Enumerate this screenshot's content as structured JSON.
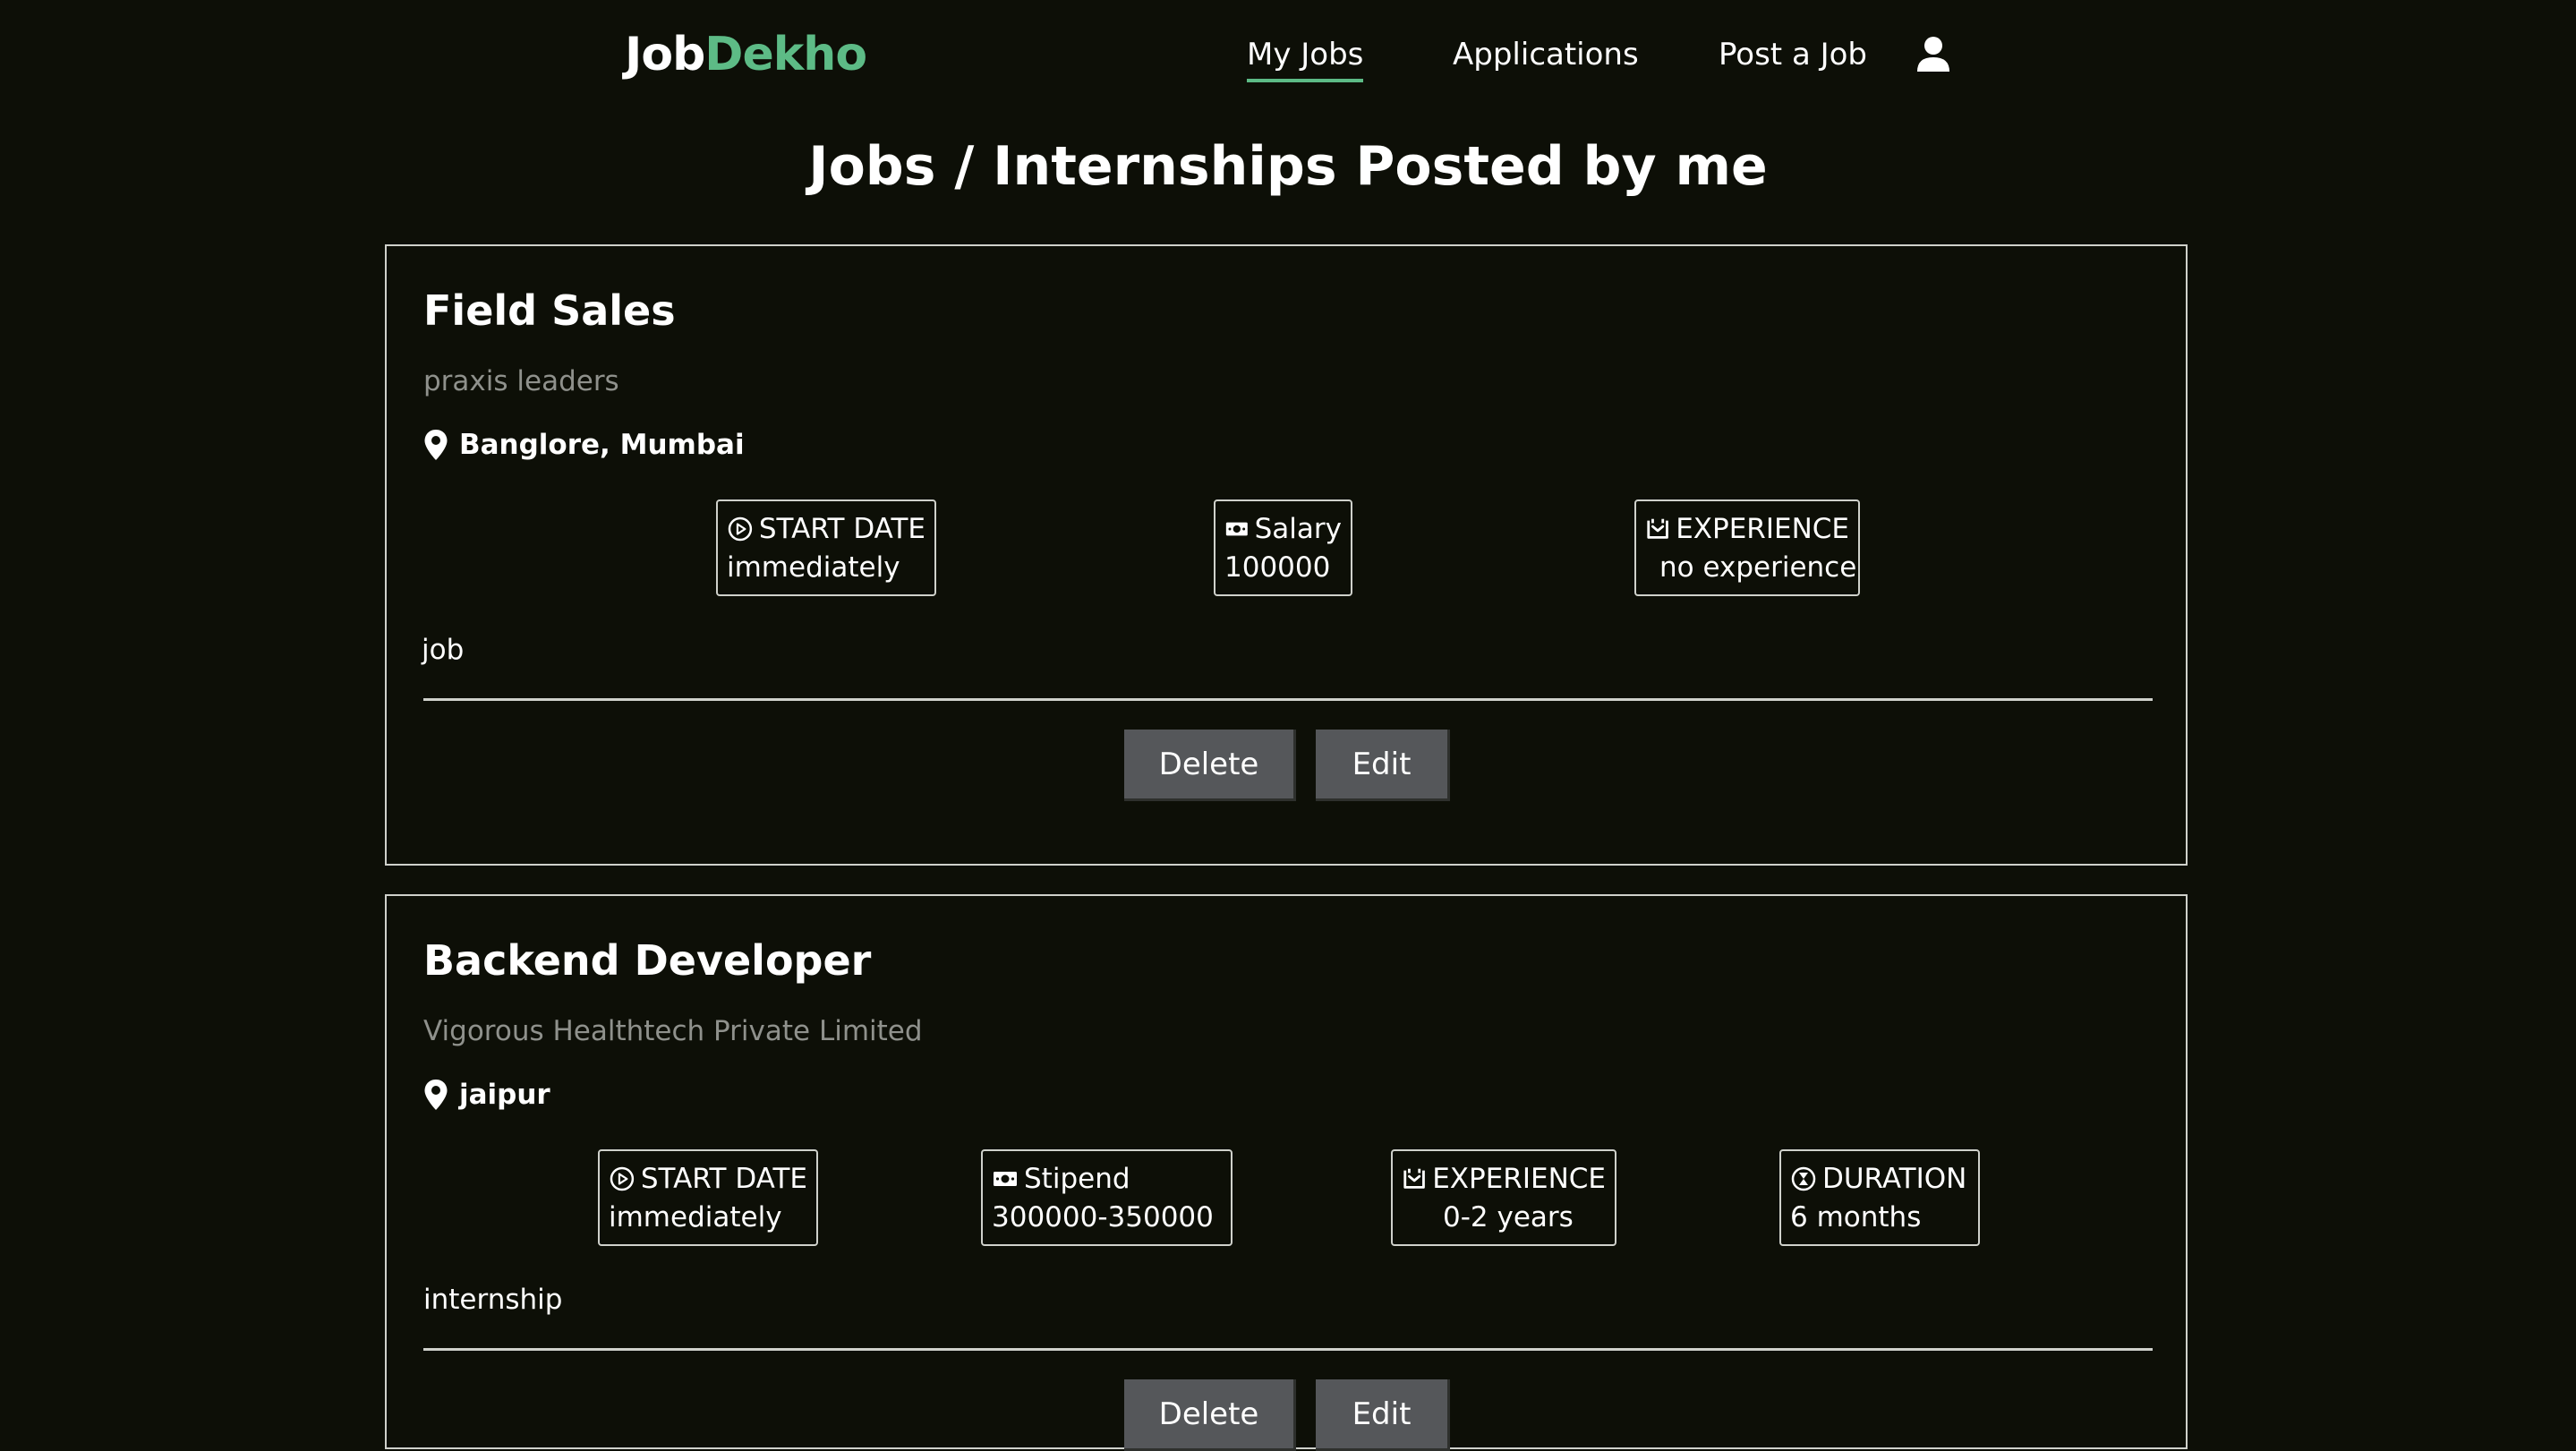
{
  "navbar": {
    "logo_part1": "Job",
    "logo_part2": "Dekho",
    "links": {
      "my_jobs": "My Jobs",
      "applications": "Applications",
      "post_job": "Post a Job"
    },
    "user_icon": "user-icon",
    "accent_color": "#5dbb86"
  },
  "page": {
    "title": "Jobs / Internships Posted by me"
  },
  "jobs": [
    {
      "title": "Field Sales",
      "company": "praxis leaders",
      "location": "Banglore, Mumbai",
      "start_label": "START DATE",
      "start_value": "immediately",
      "pay_label": "Salary",
      "pay_value": "100000",
      "exp_label": "EXPERIENCE",
      "exp_value": "no experience",
      "type": "job",
      "delete_label": "Delete",
      "edit_label": "Edit"
    },
    {
      "title": "Backend Developer",
      "company": "Vigorous Healthtech Private Limited",
      "location": "jaipur",
      "start_label": "START DATE",
      "start_value": "immediately",
      "pay_label": "Stipend",
      "pay_value": "300000-350000",
      "exp_label": "EXPERIENCE",
      "exp_value": "0-2 years",
      "duration_label": "DURATION",
      "duration_value": "6 months",
      "type": "internship",
      "delete_label": "Delete",
      "edit_label": "Edit"
    }
  ]
}
